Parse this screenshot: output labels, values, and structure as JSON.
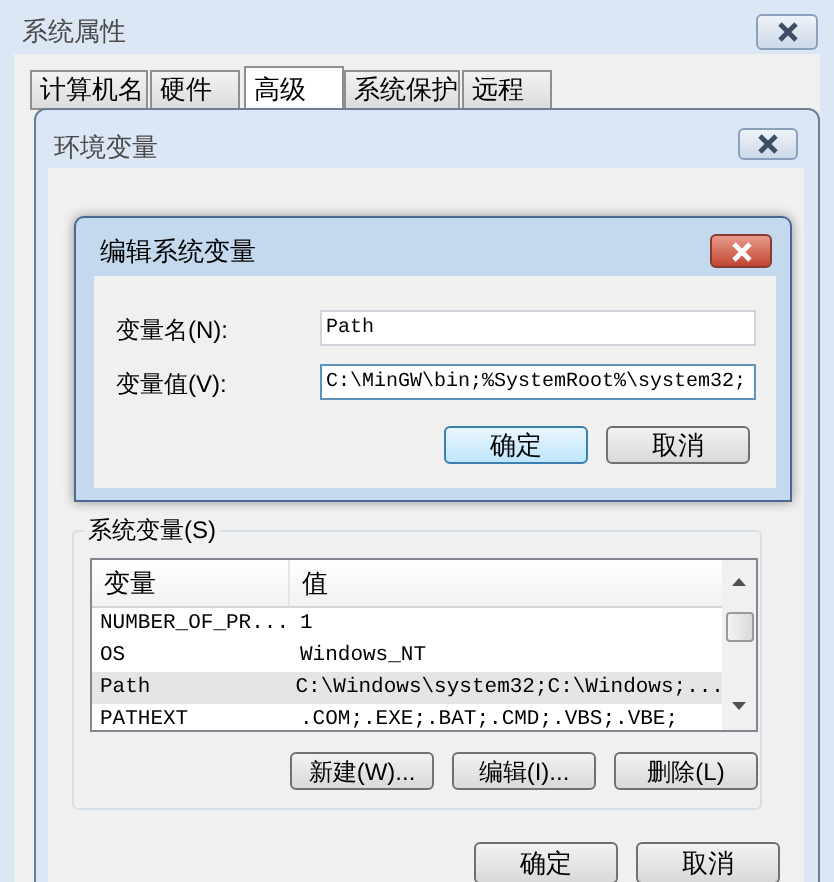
{
  "window": {
    "title": "系统属性"
  },
  "tabs": [
    {
      "label": "计算机名",
      "selected": false
    },
    {
      "label": "硬件",
      "selected": false
    },
    {
      "label": "高级",
      "selected": true
    },
    {
      "label": "系统保护",
      "selected": false
    },
    {
      "label": "远程",
      "selected": false
    }
  ],
  "env_window": {
    "title": "环境变量",
    "system_vars_label": "系统变量(S)",
    "columns": [
      "变量",
      "值"
    ],
    "rows": [
      {
        "name": "NUMBER_OF_PR...",
        "value": "1",
        "selected": false
      },
      {
        "name": "OS",
        "value": "Windows_NT",
        "selected": false
      },
      {
        "name": "Path",
        "value": "C:\\Windows\\system32;C:\\Windows;...",
        "selected": true
      },
      {
        "name": "PATHEXT",
        "value": ".COM;.EXE;.BAT;.CMD;.VBS;.VBE;",
        "selected": false
      }
    ],
    "list_buttons": [
      "新建(W)...",
      "编辑(I)...",
      "删除(L)"
    ],
    "buttons": [
      {
        "label": "确定",
        "default": false
      },
      {
        "label": "取消",
        "default": false
      }
    ]
  },
  "edit_dialog": {
    "title": "编辑系统变量",
    "fields": [
      {
        "label": "变量名(N):",
        "value": "Path"
      },
      {
        "label": "变量值(V):",
        "value": "C:\\MinGW\\bin;%SystemRoot%\\system32;"
      }
    ],
    "buttons": [
      {
        "label": "确定",
        "default": true
      },
      {
        "label": "取消",
        "default": false
      }
    ]
  }
}
